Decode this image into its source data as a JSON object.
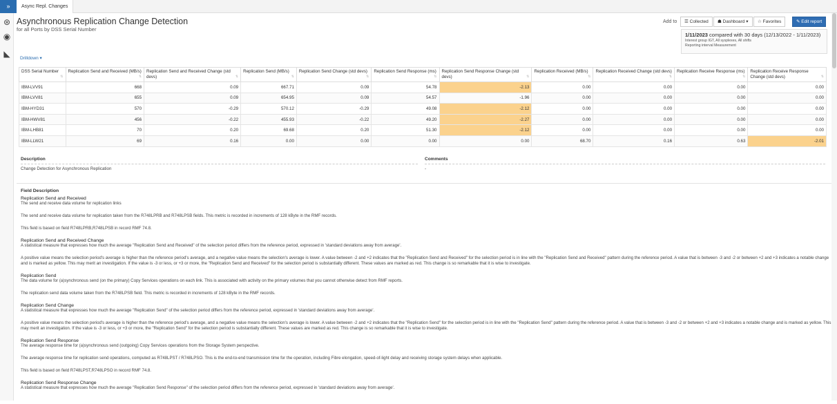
{
  "topbar": {
    "menu_glyph": "»",
    "tab": "Async Repl. Changes"
  },
  "sidebar_icons": [
    "dashboard-icon",
    "palette-icon",
    "chart-area-icon"
  ],
  "header": {
    "title": "Asynchronous Replication Change Detection",
    "subtitle": "for all Ports by DSS Serial Number",
    "add_to": "Add to",
    "buttons": {
      "collected": "☰ Collected",
      "dashboard": "☗ Dashboard ▾",
      "favorites": "☆ Favorites",
      "edit": "✎ Edit report"
    }
  },
  "compare": {
    "date": "1/11/2023",
    "text": " compared with 30 days (12/13/2022 - 1/11/2023)",
    "line2": "Interest group IGT, All sysplexes, All shifts",
    "line3": "Reporting interval Measurement"
  },
  "drilldown": "Drilldown ▾",
  "colors": {
    "highlight": "#fbd28d",
    "accent": "#2f6db3"
  },
  "table": {
    "headers": [
      "DSS Serial Number",
      "Replication Send and Received (MB/s)",
      "Replication Send and Received Change (std devs)",
      "Replication Send (MB/s)",
      "Replication Send Change (std devs)",
      "Replication Send Response (ms)",
      "Replication Send Response Change (std devs)",
      "Replication Received (MB/s)",
      "Replication Received Change (std devs)",
      "Replication Receive Response (ms)",
      "Replication Receive Response Change (std devs)"
    ],
    "rows": [
      {
        "cells": [
          "IBM-LVV91",
          "668",
          "0.09",
          "667.71",
          "0.09",
          "54.78",
          "-2.13",
          "0.00",
          "0.00",
          "0.00",
          "0.00"
        ],
        "hl": [
          6
        ]
      },
      {
        "cells": [
          "IBM-LVV81",
          "655",
          "0.09",
          "654.95",
          "0.09",
          "54.57",
          "-1.96",
          "0.00",
          "0.00",
          "0.00",
          "0.00"
        ],
        "hl": []
      },
      {
        "cells": [
          "IBM-HYD31",
          "570",
          "-0.29",
          "570.12",
          "-0.29",
          "49.08",
          "-2.12",
          "0.00",
          "0.00",
          "0.00",
          "0.00"
        ],
        "hl": [
          6
        ]
      },
      {
        "cells": [
          "IBM-HWV81",
          "456",
          "-0.22",
          "455.93",
          "-0.22",
          "49.20",
          "-2.27",
          "0.00",
          "0.00",
          "0.00",
          "0.00"
        ],
        "hl": [
          6
        ]
      },
      {
        "cells": [
          "IBM-LHB81",
          "70",
          "0.20",
          "69.68",
          "0.20",
          "51.30",
          "-2.12",
          "0.00",
          "0.00",
          "0.00",
          "0.00"
        ],
        "hl": [
          6
        ]
      },
      {
        "cells": [
          "IBM-LLW21",
          "69",
          "0.16",
          "0.00",
          "0.00",
          "0.00",
          "0.00",
          "68.70",
          "0.16",
          "0.63",
          "-2.01"
        ],
        "hl": [
          10
        ]
      }
    ]
  },
  "description": {
    "label": "Description",
    "value": "Change Detection for Asynchronous Replication",
    "comments_label": "Comments",
    "comments_value": "-"
  },
  "field_description": {
    "title": "Field Description",
    "items": [
      {
        "name": "Replication Send and Received",
        "paras": [
          "The send and receive data volume for replication links",
          "The send and receive data volume for replication taken from the R748LPRB and R748LPSB fields. This metric is recorded in increments of 128 kByte in the RMF records.",
          "This field is based on field R748LPRB,R748LPSB in record RMF 74.8."
        ]
      },
      {
        "name": "Replication Send and Received Change",
        "paras": [
          "A statistical measure that expresses how much the average \"Replication Send and Received\" of the selection period differs from the reference period, expressed in 'standard deviations away from average'.",
          "A positive value means the selection period's average is higher than the reference period's average, and a negative value means the selection's average is lower. A value between -2 and +2 indicates that the \"Replication Send and Received\" for the selection period is in line with the \"Replication Send and Received\" pattern during the reference period. A value that is between -3 and -2 or between +2 and +3 indicates a notable change and is marked as yellow. This may merit an investigation. If the value is -3 or less, or +3 or more, the \"Replication Send and Received\" for the selection period is substantially different. These values are marked as red. This change is so remarkable that it is wise to investigate."
        ]
      },
      {
        "name": "Replication Send",
        "paras": [
          "The data volume for (a)synchronous send (on the primary) Copy Services operations on each link. This is associated with activity on the primary volumes that you cannot otherwise detect from RMF reports.",
          "The replication send data volume taken from the R748LPSB field. This metric is recorded in increments of 128 kByte in the RMF records."
        ]
      },
      {
        "name": "Replication Send Change",
        "paras": [
          "A statistical measure that expresses how much the average \"Replication Send\" of the selection period differs from the reference period, expressed in 'standard deviations away from average'.",
          "A positive value means the selection period's average is higher than the reference period's average, and a negative value means the selection's average is lower. A value between -2 and +2 indicates that the \"Replication Send\" for the selection period is in line with the \"Replication Send\" pattern during the reference period. A value that is between -3 and -2 or between +2 and +3 indicates a notable change and is marked as yellow. This may merit an investigation. If the value is -3 or less, or +3 or more, the \"Replication Send\" for the selection period is substantially different. These values are marked as red. This change is so remarkable that it is wise to investigate."
        ]
      },
      {
        "name": "Replication Send Response",
        "paras": [
          "The average response time for (a)synchronous send (outgoing) Copy Services operations from the Storage System perspective.",
          "The average response time for replication send operations, computed as R748LPST / R748LPSO. This is the end-to-end transmission time for the operation, including Fibre elongation, speed-of-light delay and receiving storage system delays when applicable.",
          "This field is based on field R748LPST,R748LPSO in record RMF 74.8."
        ]
      },
      {
        "name": "Replication Send Response Change",
        "paras": [
          "A statistical measure that expresses how much the average \"Replication Send Response\" of the selection period differs from the reference period, expressed in 'standard deviations away from average'."
        ]
      }
    ]
  }
}
